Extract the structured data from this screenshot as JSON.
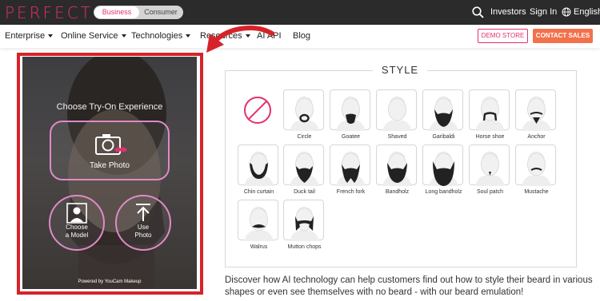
{
  "header": {
    "logo": "PERFECT",
    "segment": {
      "active": "Business",
      "inactive": "Consumer"
    },
    "links": {
      "investors": "Investors",
      "sign_in": "Sign In",
      "language": "English"
    }
  },
  "nav": {
    "items": [
      "Enterprise",
      "Online Service",
      "Technologies",
      "Resources",
      "AI API",
      "Blog"
    ],
    "demo_store": "DEMO STORE",
    "contact_sales": "CONTACT SALES"
  },
  "tryon": {
    "title": "Choose Try-On Experience",
    "take_photo": "Take Photo",
    "choose_model": [
      "Choose",
      "a Model"
    ],
    "use_photo": [
      "Use",
      "Photo"
    ],
    "powered_by": "Powered by YouCam Makeup"
  },
  "style": {
    "heading": "STYLE",
    "none_icon": "no-beard-icon",
    "options": [
      "Circle",
      "Goatee",
      "Shaved",
      "Garibaldi",
      "Horse shoe",
      "Anchor",
      "Chin curtain",
      "Duck tail",
      "French fork",
      "Bandholz",
      "Long bandholz",
      "Soul patch",
      "Mustache",
      "Walrus",
      "Mutton chops"
    ]
  },
  "description": "Discover how AI technology can help customers find out how to style their beard in various shapes or even see themselves with no beard - with our beard emulation!",
  "colors": {
    "brand_pink": "#e2306c",
    "contact_orange": "#f2714b",
    "highlight_red": "#d6232a"
  }
}
